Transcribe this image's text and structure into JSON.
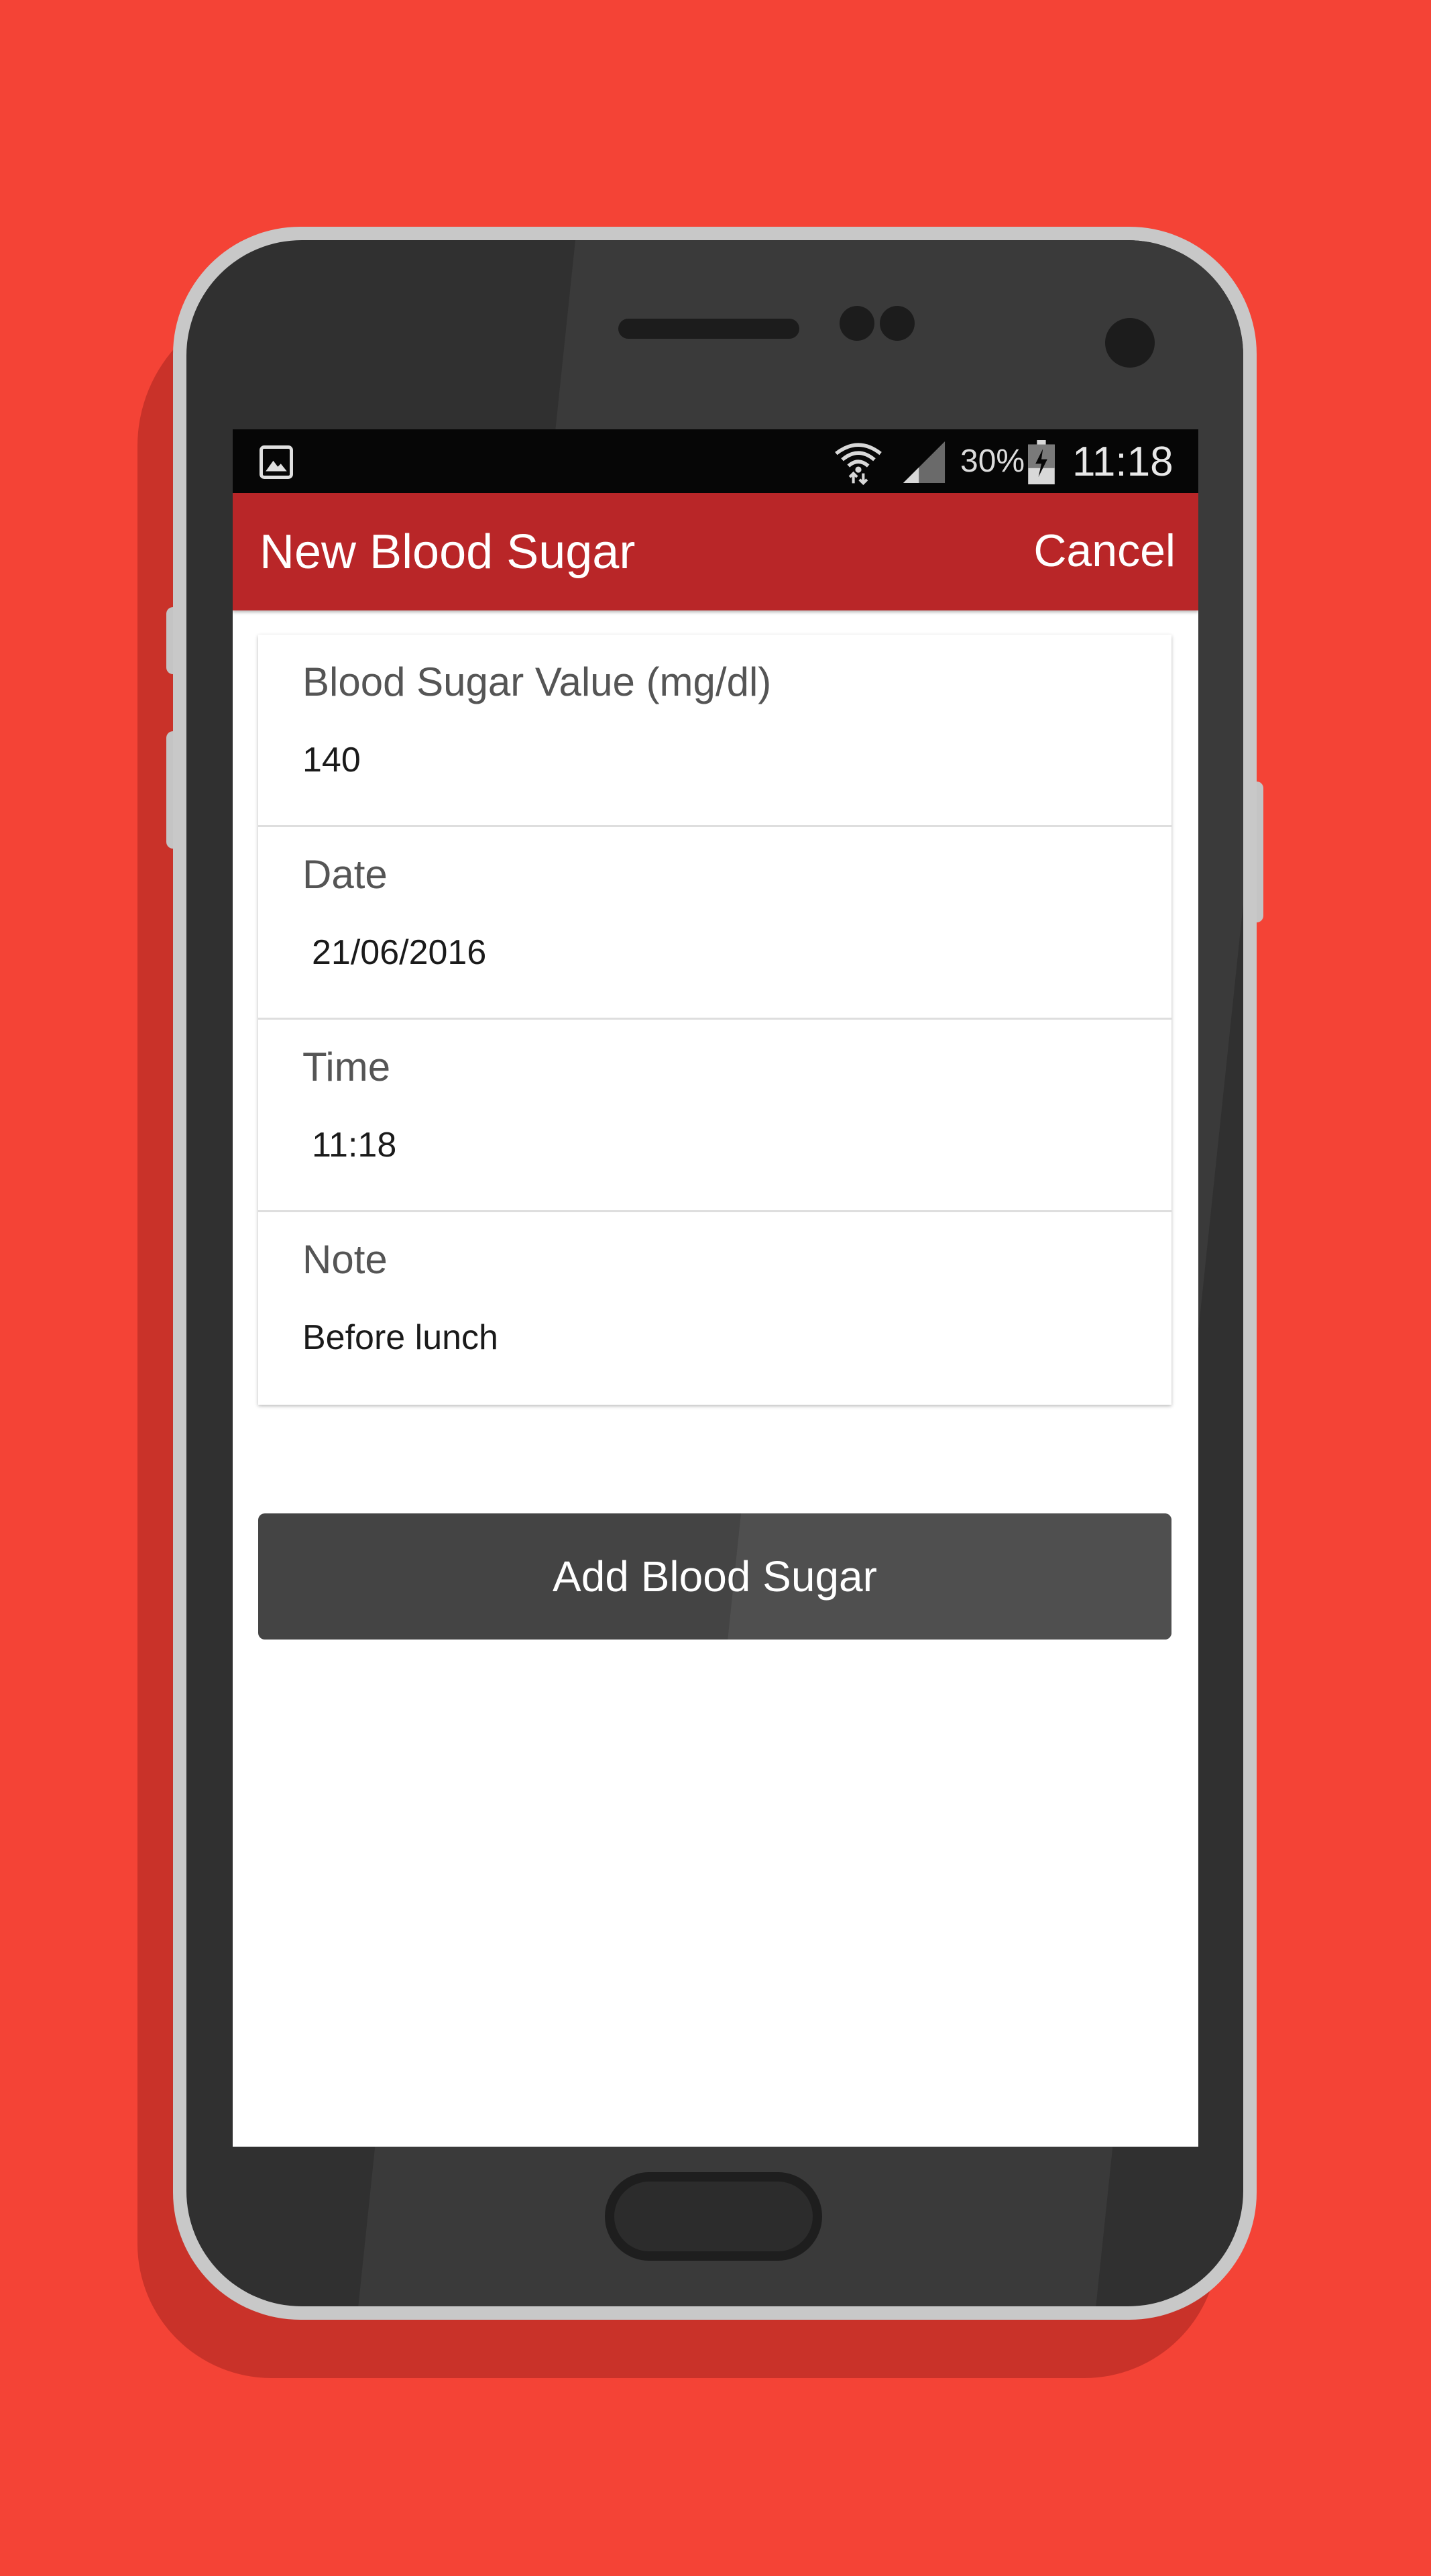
{
  "colors": {
    "background": "#f44336",
    "app_bar": "#b92628",
    "status_bar": "#060606",
    "button": "#444444"
  },
  "status_bar": {
    "notification_icon": "image-icon",
    "wifi_icon": "wifi-icon",
    "signal_icon": "signal-icon",
    "battery_percent": "30%",
    "battery_icon": "battery-charging-icon",
    "time": "11:18"
  },
  "app_bar": {
    "title": "New Blood Sugar",
    "cancel_label": "Cancel"
  },
  "form": {
    "fields": [
      {
        "label": "Blood Sugar Value (mg/dl)",
        "value": "140"
      },
      {
        "label": "Date",
        "value": "21/06/2016"
      },
      {
        "label": "Time",
        "value": "11:18"
      },
      {
        "label": "Note",
        "value": "Before lunch"
      }
    ]
  },
  "actions": {
    "add_label": "Add Blood Sugar"
  }
}
